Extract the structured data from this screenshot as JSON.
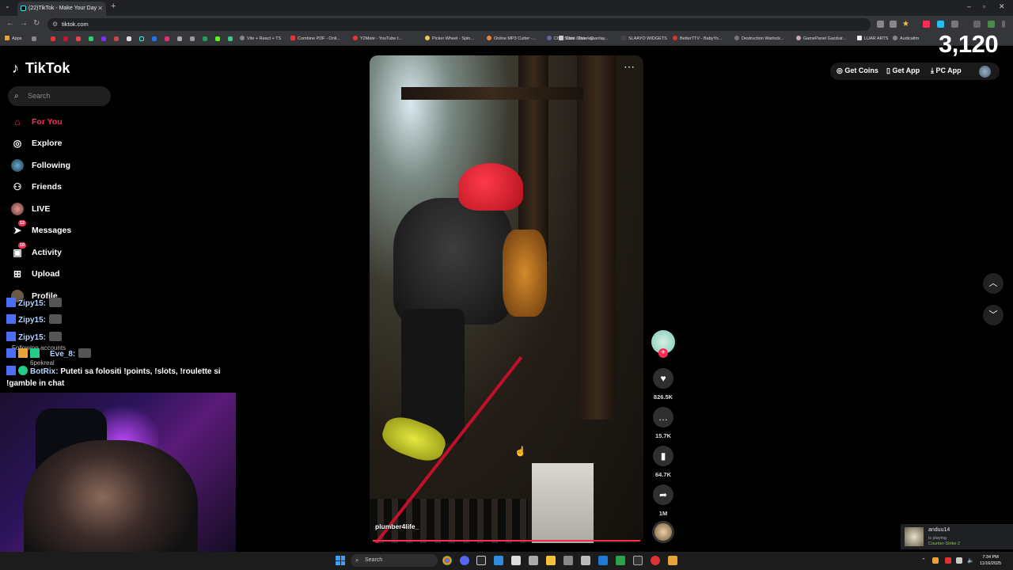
{
  "browser": {
    "tab_title": "(22)TikTok - Make Your Day",
    "url": "tiktok.com",
    "bookmarks": [
      "Apps",
      "Vite + React + TS",
      "Combine PDF - Onli...",
      "Y2Mate - YouTube t...",
      "Picker Wheel - Spin...",
      "Online MP3 Cutter -...",
      "Chat Stats - Overlay...",
      "SLAAYO WIDGETS",
      "BetterTTV - BabyYo...",
      "Destruction Warlock...",
      "GamePanel Gazduir...",
      "LUAR ARTS",
      "Audicaltm"
    ]
  },
  "overlay": {
    "counter": "3,120"
  },
  "tiktok": {
    "logo": "TikTok",
    "search_placeholder": "Search",
    "nav": {
      "for_you": "For You",
      "explore": "Explore",
      "following": "Following",
      "friends": "Friends",
      "live": "LIVE",
      "messages": "Messages",
      "messages_badge": "12",
      "activity": "Activity",
      "activity_badge": "10",
      "upload": "Upload",
      "profile": "Profile"
    },
    "following_accounts_label": "Following accounts",
    "following_accounts": [
      "6pekreal"
    ],
    "header": {
      "get_coins": "Get Coins",
      "get_app": "Get App",
      "pc_app": "PC App"
    },
    "video": {
      "author": "plumber4life_"
    },
    "actions": {
      "likes": "826.5K",
      "comments": "15.7K",
      "saves": "64.7K",
      "shares": "1M"
    }
  },
  "chat": {
    "messages": [
      {
        "user": "Zipy15:",
        "text": ""
      },
      {
        "user": "Zipy15:",
        "text": ""
      },
      {
        "user": "Zipy15:",
        "text": ""
      },
      {
        "user": "Eve_8:",
        "text": ""
      },
      {
        "user": "BotRix:",
        "text": "Puteti sa folositi !points, !slots, !roulette si"
      },
      {
        "user": "",
        "text": "!gamble in chat"
      }
    ]
  },
  "steam_notification": {
    "name": "anduu14",
    "status": "is playing",
    "game": "Counter-Strike 2"
  },
  "taskbar": {
    "search_label": "Search",
    "time": "7:34 PM",
    "date": "11/16/2025"
  },
  "colors": {
    "accent": "#fe2c55",
    "background": "#000000"
  },
  "icons": {
    "for_you": "home-icon",
    "explore": "compass-icon",
    "friends": "people-icon",
    "messages": "send-icon",
    "activity": "inbox-icon",
    "upload": "plus-square-icon",
    "like": "heart-icon",
    "comment": "comment-icon",
    "save": "bookmark-icon",
    "share": "share-icon"
  }
}
